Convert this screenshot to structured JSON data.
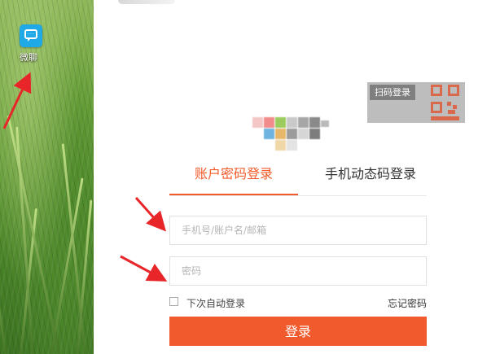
{
  "desktop": {
    "icon_name": "chat-bubble-icon",
    "icon_label": "微聊"
  },
  "login": {
    "qr_tag": "扫码登录",
    "tabs": [
      {
        "label": "账户密码登录",
        "active": true
      },
      {
        "label": "手机动态码登录",
        "active": false
      }
    ],
    "account_placeholder": "手机号/账户名/邮箱",
    "password_placeholder": "密码",
    "remember_label": "下次自动登录",
    "forgot_label": "忘记密码",
    "submit_label": "登录"
  },
  "colors": {
    "accent": "#f15a2a",
    "annotation_arrow": "#e8262a",
    "desktop_icon": "#1fa9e6"
  }
}
